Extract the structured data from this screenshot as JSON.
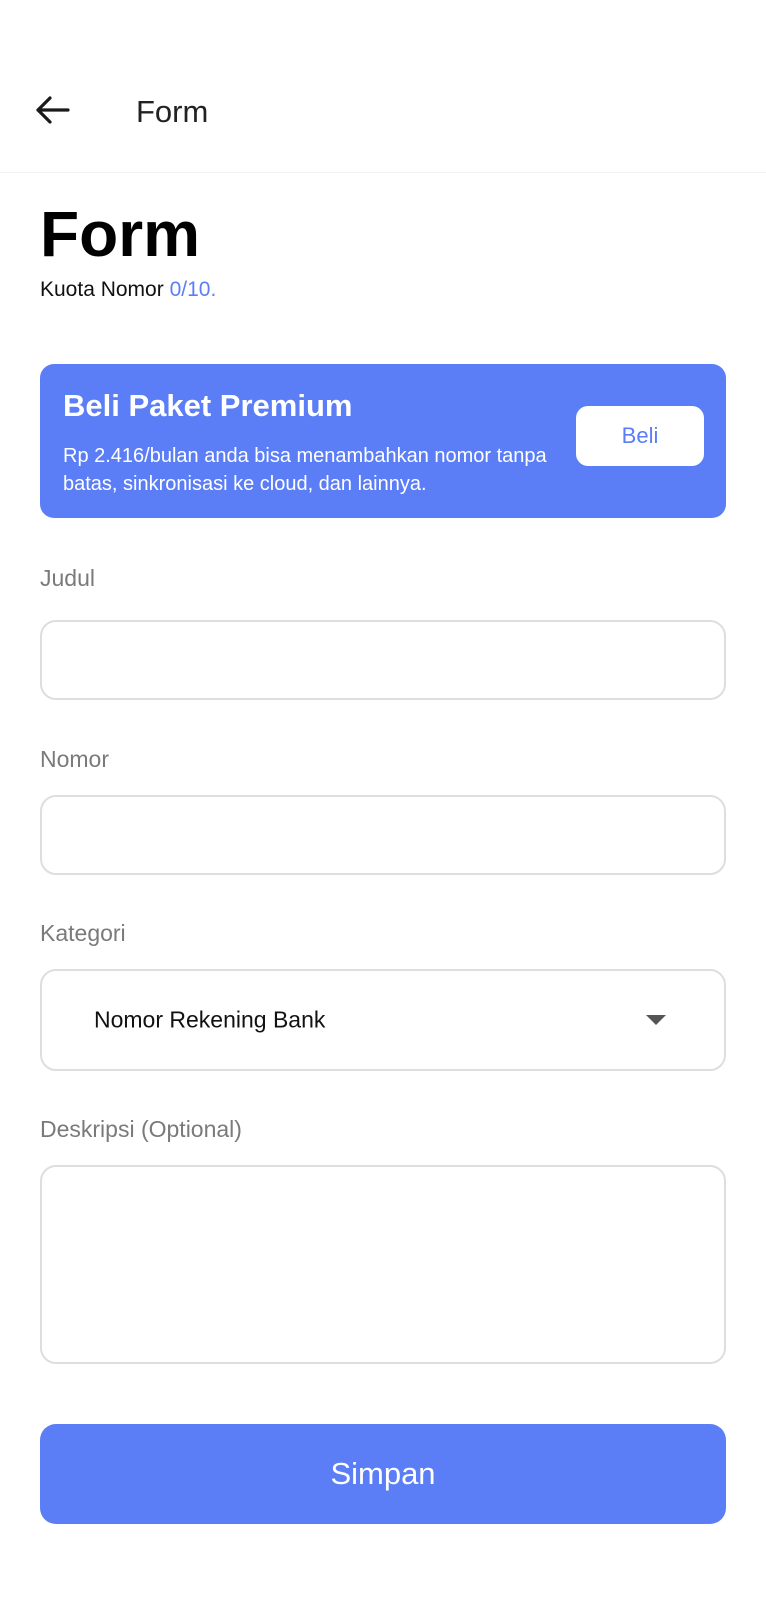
{
  "app_bar": {
    "title": "Form",
    "back_icon": "arrow-left-icon"
  },
  "header": {
    "title": "Form",
    "quota_label": "Kuota Nomor",
    "quota_value": "0/10."
  },
  "premium": {
    "title": "Beli Paket Premium",
    "description": "Rp 2.416/bulan anda bisa menambahkan nomor tanpa batas, sinkronisasi ke cloud, dan lainnya.",
    "button_label": "Beli"
  },
  "form": {
    "judul": {
      "label": "Judul",
      "value": ""
    },
    "nomor": {
      "label": "Nomor",
      "value": ""
    },
    "kategori": {
      "label": "Kategori",
      "selected": "Nomor Rekening Bank",
      "dropdown_icon": "caret-down-icon"
    },
    "deskripsi": {
      "label": "Deskripsi (Optional)",
      "value": ""
    }
  },
  "actions": {
    "save_label": "Simpan"
  },
  "colors": {
    "accent": "#5b7ef6",
    "label": "#7a7a7a",
    "border": "#dedede"
  }
}
